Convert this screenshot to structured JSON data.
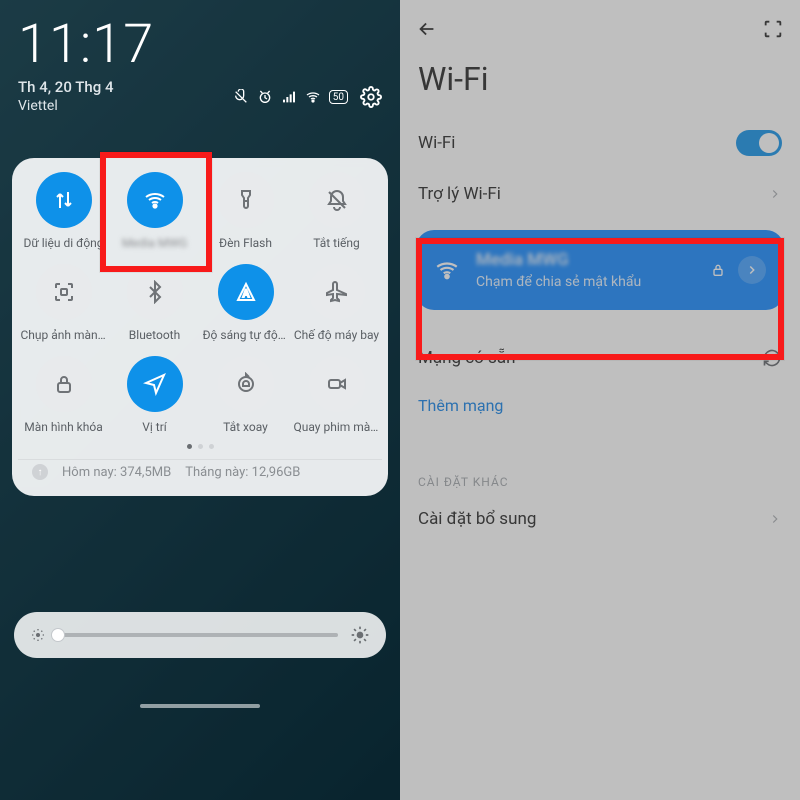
{
  "left": {
    "time": "11:17",
    "date": "Th 4, 20 Thg 4",
    "carrier": "Viettel",
    "battery": "50",
    "tiles": [
      {
        "icon": "data-arrows",
        "state": "on",
        "label": "Dữ liệu di động"
      },
      {
        "icon": "wifi",
        "state": "on",
        "label": "Media MWG",
        "blurred": true
      },
      {
        "icon": "flashlight",
        "state": "off",
        "label": "Đèn Flash"
      },
      {
        "icon": "mute",
        "state": "off",
        "label": "Tắt tiếng"
      },
      {
        "icon": "screenshot",
        "state": "off",
        "label": "Chụp ảnh màn hình"
      },
      {
        "icon": "bluetooth",
        "state": "off",
        "label": "Bluetooth"
      },
      {
        "icon": "auto-bright",
        "state": "on",
        "label": "Độ sáng tự động"
      },
      {
        "icon": "airplane",
        "state": "off",
        "label": "Chế độ máy bay"
      },
      {
        "icon": "lock",
        "state": "off",
        "label": "Màn hình khóa"
      },
      {
        "icon": "location",
        "state": "on",
        "label": "Vị trí"
      },
      {
        "icon": "rotate-lock",
        "state": "off",
        "label": "Tắt xoay"
      },
      {
        "icon": "video",
        "state": "off",
        "label": "Quay phim màn hình"
      }
    ],
    "usage_today_label": "Hôm nay:",
    "usage_today_value": "374,5MB",
    "usage_month_label": "Tháng này:",
    "usage_month_value": "12,96GB"
  },
  "right": {
    "title": "Wi-Fi",
    "toggle_label": "Wi-Fi",
    "assistant_label": "Trợ lý Wi-Fi",
    "connected": {
      "ssid": "Media MWG",
      "subtitle": "Chạm để chia sẻ mật khẩu"
    },
    "available_label": "Mạng có sẵn",
    "add_network_label": "Thêm mạng",
    "more_section": "CÀI ĐẶT KHÁC",
    "additional_label": "Cài đặt bổ sung"
  }
}
